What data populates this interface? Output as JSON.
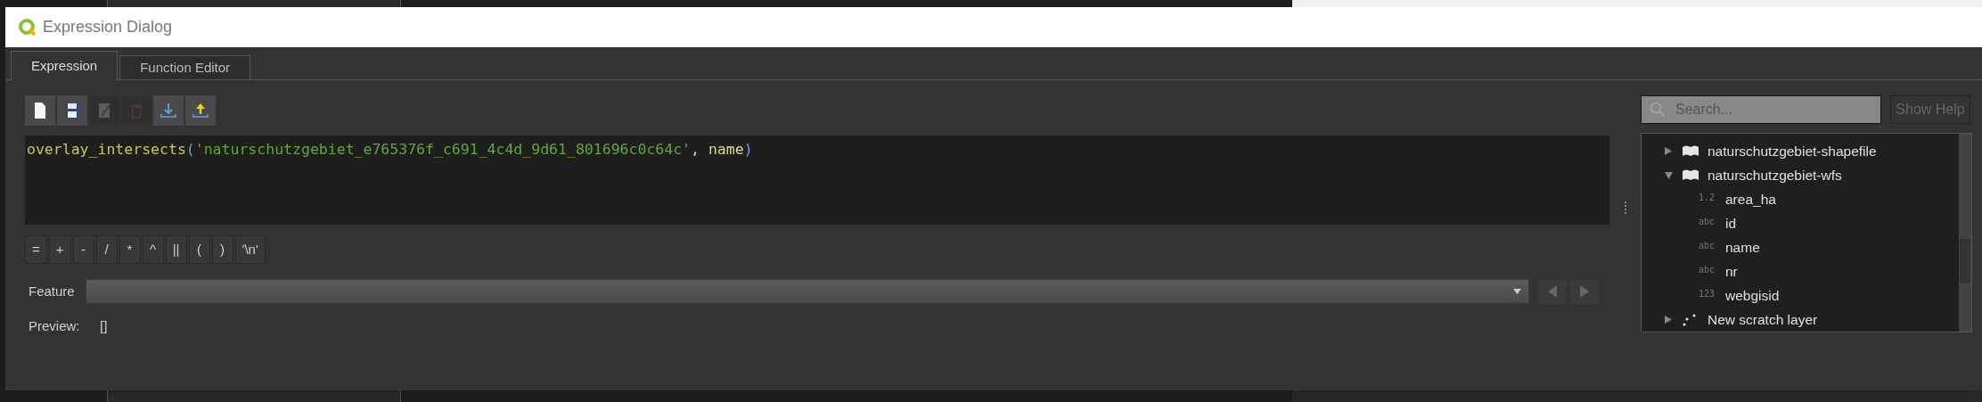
{
  "window": {
    "title": "Expression Dialog"
  },
  "tabs": [
    {
      "label": "Expression",
      "selected": true
    },
    {
      "label": "Function Editor",
      "selected": false
    }
  ],
  "toolbar": [
    {
      "kind": "new",
      "disabled": false
    },
    {
      "kind": "save",
      "disabled": false
    },
    {
      "kind": "edit",
      "disabled": true
    },
    {
      "kind": "delete",
      "disabled": true
    },
    {
      "kind": "import",
      "disabled": false
    },
    {
      "kind": "export",
      "disabled": false
    }
  ],
  "expression": [
    {
      "kind": "function",
      "text": "overlay_intersects"
    },
    {
      "kind": "paren",
      "text": "("
    },
    {
      "kind": "string",
      "text": "'naturschutzgebiet_e765376f_c691_4c4d_9d61_801696c0c64c'"
    },
    {
      "kind": "plain",
      "text": ", "
    },
    {
      "kind": "field",
      "text": "name"
    },
    {
      "kind": "paren",
      "text": ")"
    }
  ],
  "operators": [
    "=",
    "+",
    "-",
    "/",
    "*",
    "^",
    "||",
    "(",
    ")",
    "'\\n'"
  ],
  "feature": {
    "label": "Feature"
  },
  "preview": {
    "label": "Preview:",
    "value": "[]"
  },
  "search": {
    "placeholder": "Search..."
  },
  "show_help": {
    "label": "Show Help",
    "disabled": true
  },
  "tree": [
    {
      "kind": "polygon_layer",
      "label": "naturschutzgebiet-shapefile",
      "expanded": false
    },
    {
      "kind": "polygon_layer",
      "label": "naturschutzgebiet-wfs",
      "expanded": true,
      "children": [
        {
          "type_tag": "1.2",
          "label": "area_ha"
        },
        {
          "type_tag": "abc",
          "label": "id"
        },
        {
          "type_tag": "abc",
          "label": "name"
        },
        {
          "type_tag": "abc",
          "label": "nr"
        },
        {
          "type_tag": "123",
          "label": "webgisid"
        }
      ]
    },
    {
      "kind": "point_layer",
      "label": "New scratch layer",
      "expanded": false
    }
  ]
}
